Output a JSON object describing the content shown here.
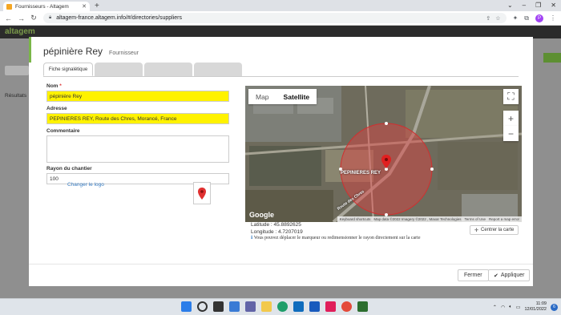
{
  "browser": {
    "tab_title": "Fournisseurs - Altagem",
    "url": "altagem-france.altagem.info/#/directories/suppliers"
  },
  "app": {
    "logo": "altagem",
    "results_label": "Résultats"
  },
  "modal": {
    "title": "pépinière Rey",
    "subtitle": "Fournisseur",
    "tabs": [
      {
        "label": "Fiche signalétique",
        "active": true
      },
      {
        "label": "",
        "active": false
      },
      {
        "label": "",
        "active": false
      },
      {
        "label": "",
        "active": false
      }
    ],
    "form": {
      "nom_label": "Nom",
      "nom_required": "*",
      "nom_value": "pépinière Rey",
      "adresse_label": "Adresse",
      "adresse_value": "PEPINIERES REY, Route des Chres, Morancé, France",
      "commentaire_label": "Commentaire",
      "rayon_label": "Rayon du chantier",
      "rayon_value": "100",
      "change_logo": "Changer le logo"
    },
    "map": {
      "type_map": "Map",
      "type_satellite": "Satellite",
      "selected_type": "Satellite",
      "marker_label": "PEPINIERES REY",
      "road_label": "Route des Chres",
      "google": "Google",
      "attribution": [
        "Keyboard shortcuts",
        "Map data ©2022 Imagery ©2022 , Maxar Technologies",
        "Terms of Use",
        "Report a map error"
      ],
      "latitude": "Latitude : 45.8892625",
      "longitude": "Longitude : 4.7207019",
      "hint": "Vous pouvez déplacer le marqueur ou redimensionner le rayon directement sur la carte",
      "center_button": "Centrer la carte"
    },
    "buttons": {
      "close": "Fermer",
      "apply": "Appliquer"
    }
  },
  "taskbar": {
    "time": "11:09",
    "date": "12/01/2022",
    "notifications": "6"
  },
  "colors": {
    "highlight": "#fff200",
    "accent": "#7ab648",
    "radius_circle": "#e04040"
  }
}
